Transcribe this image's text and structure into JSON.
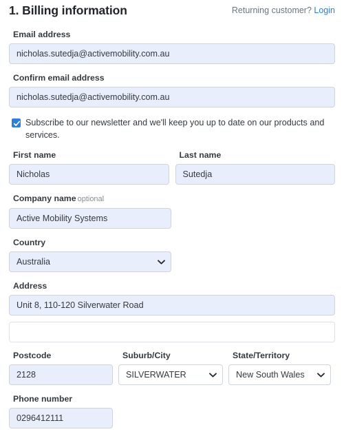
{
  "header": {
    "title": "1. Billing information",
    "returning_text": "Returning customer?",
    "login_label": "Login"
  },
  "colors": {
    "link": "#2f7ed8",
    "autofill_background": "#e8eefb",
    "checkbox_accent": "#2f7ed8",
    "label_text": "#343a40",
    "muted_text": "#6c757d",
    "border": "#ced4da"
  },
  "fields": {
    "email": {
      "label": "Email address",
      "value": "nicholas.sutedja@activemobility.com.au",
      "placeholder": ""
    },
    "confirm_email": {
      "label": "Confirm email address",
      "value": "nicholas.sutedja@activemobility.com.au",
      "placeholder": ""
    },
    "newsletter": {
      "label": "Subscribe to our newsletter and we'll keep you up to date on our products and services.",
      "checked": "true"
    },
    "first_name": {
      "label": "First name",
      "value": "Nicholas",
      "placeholder": ""
    },
    "last_name": {
      "label": "Last name",
      "value": "Sutedja",
      "placeholder": ""
    },
    "company_name": {
      "label": "Company name",
      "optional_tag": "optional",
      "value": "Active Mobility Systems",
      "placeholder": ""
    },
    "country": {
      "label": "Country",
      "value": "Australia",
      "options": [
        "Australia"
      ]
    },
    "address1": {
      "label": "Address",
      "value": "Unit 8, 110-120 Silverwater Road",
      "placeholder": ""
    },
    "address2": {
      "label": "",
      "value": "",
      "placeholder": ""
    },
    "postcode": {
      "label": "Postcode",
      "value": "2128",
      "placeholder": ""
    },
    "suburb": {
      "label": "Suburb/City",
      "value": "SILVERWATER",
      "options": [
        "SILVERWATER"
      ]
    },
    "state": {
      "label": "State/Territory",
      "value": "New South Wales",
      "options": [
        "New South Wales"
      ]
    },
    "phone": {
      "label": "Phone number",
      "value": "0296412111",
      "placeholder": ""
    }
  }
}
